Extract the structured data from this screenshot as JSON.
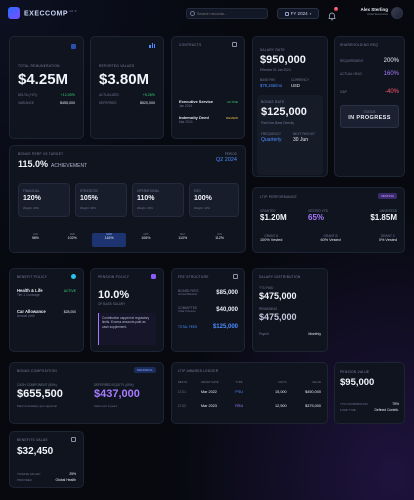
{
  "header": {
    "brand": "EXECCOMP",
    "version": "v2.4",
    "search_placeholder": "Search records...",
    "fy": "FY 2024",
    "bell_count": "3",
    "user_name": "Alex Sterling",
    "user_role": "Chief Executive"
  },
  "total_remuneration": {
    "label": "TOTAL REMUNERATION",
    "value": "$4.25M",
    "delta_label": "DELTA (YOY)",
    "delta_value": "+12.00%",
    "variance_label": "VARIANCE",
    "variance_value": "$455,000"
  },
  "reported_values": {
    "label": "REPORTED VALUES",
    "value": "$3.80M",
    "actualized_label": "ACTUALIZED",
    "actualized_value": "+5.26%",
    "deferred_label": "DEFERRED",
    "deferred_value": "$520,000"
  },
  "contracts": {
    "title": "CONTRACTS",
    "items": [
      {
        "name": "Executive Service",
        "date": "Jan 2024",
        "status": "ACTIVE"
      },
      {
        "name": "Indemnity Deed",
        "date": "Mar 2024",
        "status": "REVIEW"
      }
    ]
  },
  "base_salary": {
    "label": "SALARY RATE",
    "value": "$950,000",
    "effective": "Effective 01 Jan 2024",
    "base_label": "BASE PAY",
    "base_value": "$79,166/mo",
    "currency_label": "CURRENCY",
    "currency_value": "USD",
    "bonus_label": "BONUS RATE",
    "bonus_value": "$125,000",
    "bonus_note": "Paid Non-Base Directly",
    "freq_label": "FREQUENCY",
    "freq_value": "Quarterly",
    "next_label": "NEXT PAYOUT",
    "next_value": "30 Jun"
  },
  "shareholding": {
    "title": "SHAREHOLDING REQ",
    "requirement_label": "REQUIREMENT",
    "requirement_value": "200%",
    "actual_label": "ACTUAL HELD",
    "actual_value": "160%",
    "gap_label": "GAP",
    "gap_value": "-40%",
    "status_label": "STATUS",
    "status_value": "IN PROGRESS"
  },
  "bonus_perf": {
    "title": "BONUS PERF VS TARGET",
    "value": "115.0%",
    "value_suffix": "ACHIEVEMENT",
    "period_label": "PERIOD",
    "period_value": "Q2 2024",
    "metrics": [
      {
        "name": "FINANCIAL",
        "value": "120%",
        "weight": "Weight: 40%"
      },
      {
        "name": "STRATEGIC",
        "value": "105%",
        "weight": "Weight: 30%"
      },
      {
        "name": "OPERATIONAL",
        "value": "110%",
        "weight": "Weight: 20%"
      },
      {
        "name": "ESG",
        "value": "100%",
        "weight": "Weight: 10%"
      }
    ],
    "months": [
      {
        "m": "JAN",
        "v": "98%"
      },
      {
        "m": "FEB",
        "v": "102%"
      },
      {
        "m": "MAR",
        "v": "116%"
      },
      {
        "m": "APR",
        "v": "106%"
      },
      {
        "m": "MAY",
        "v": "110%"
      },
      {
        "m": "JUN",
        "v": "112%"
      }
    ]
  },
  "ltip": {
    "title": "LTIP PERFORMANCE",
    "badge": "VESTING",
    "granted_label": "GRANTED",
    "granted_value": "$1.20M",
    "vested_label": "VESTED YTD",
    "vested_value": "65%",
    "unvested_label": "UNVESTED",
    "unvested_value": "$1.85M",
    "grants": [
      {
        "name": "GRANT A",
        "status": "100% Vested"
      },
      {
        "name": "GRANT B",
        "status": "60% Vested"
      },
      {
        "name": "GRANT C",
        "status": "0% Vested"
      }
    ]
  },
  "benefit_policy": {
    "title": "BENEFIT POLICY",
    "items": [
      {
        "name": "Health & Life",
        "sub": "Tier 1 Coverage",
        "value": "ACTIVE"
      },
      {
        "name": "Car Allowance",
        "sub": "Annual Limit",
        "value": "$28,000"
      }
    ]
  },
  "pension_policy": {
    "title": "PENSION POLICY",
    "value": "10.0%",
    "sub": "OF BASE SALARY",
    "note": "Contribution capped at regulatory limits. Excess amounts paid as cash supplement."
  },
  "fee_structure": {
    "title": "FEE STRUCTURE",
    "rows": [
      {
        "name": "BOARD FEES",
        "sub": "Annual Retainer",
        "value": "$85,000"
      },
      {
        "name": "COMMITTEE",
        "sub": "Chair Premium",
        "value": "$40,000"
      },
      {
        "name": "TOTAL FEES",
        "sub": "",
        "value": "$125,000"
      }
    ]
  },
  "salary_dist": {
    "title": "SALARY DISTRIBUTION",
    "ytd_label": "YTD PAID",
    "ytd_value": "$475,000",
    "remain_label": "REMAINING",
    "remain_value": "$475,000",
    "payroll_label": "Payroll",
    "payroll_value": "Monthly"
  },
  "bonus_comp": {
    "title": "BONUS COMPOSITION",
    "badge": "DEFERRAL",
    "cash_label": "CASH COMPONENT (50%)",
    "cash_value": "$655,500",
    "cash_note": "Paid immediately upon approval",
    "equity_label": "DEFERRED EQUITY (40%)",
    "equity_value": "$437,000",
    "equity_note": "Vests over 3 years"
  },
  "ltip_ledger": {
    "title": "LTIP AWARDS LEDGER",
    "headers": [
      "REF ID",
      "GRANT DATE",
      "TYPE",
      "UNITS",
      "VALUE"
    ],
    "rows": [
      {
        "ref": "LT-01",
        "date": "Mar 2022",
        "type": "PSU",
        "units": "15,000",
        "value": "$450,000"
      },
      {
        "ref": "LT-02",
        "date": "Mar 2023",
        "type": "RSU",
        "units": "12,500",
        "value": "$375,000"
      }
    ]
  },
  "pension_value": {
    "title": "PENSION VALUE",
    "value": "$95,000",
    "contrib_label": "YTD CONTRIBUTION",
    "contrib_value": "75%",
    "fund_label": "FUND TYPE",
    "fund_value": "Defined Contrib."
  },
  "benefits_value": {
    "title": "BENEFITS VALUE",
    "value": "$32,450",
    "ratio_label": "VS BASE SALARY",
    "ratio_value": "25%",
    "provider_label": "PROVIDER",
    "provider_value": "Global Health"
  },
  "colors": {
    "accent": "#4c8dff",
    "positive": "#37d67a",
    "negative": "#ff5a6a",
    "highlight": "#a77bff"
  }
}
